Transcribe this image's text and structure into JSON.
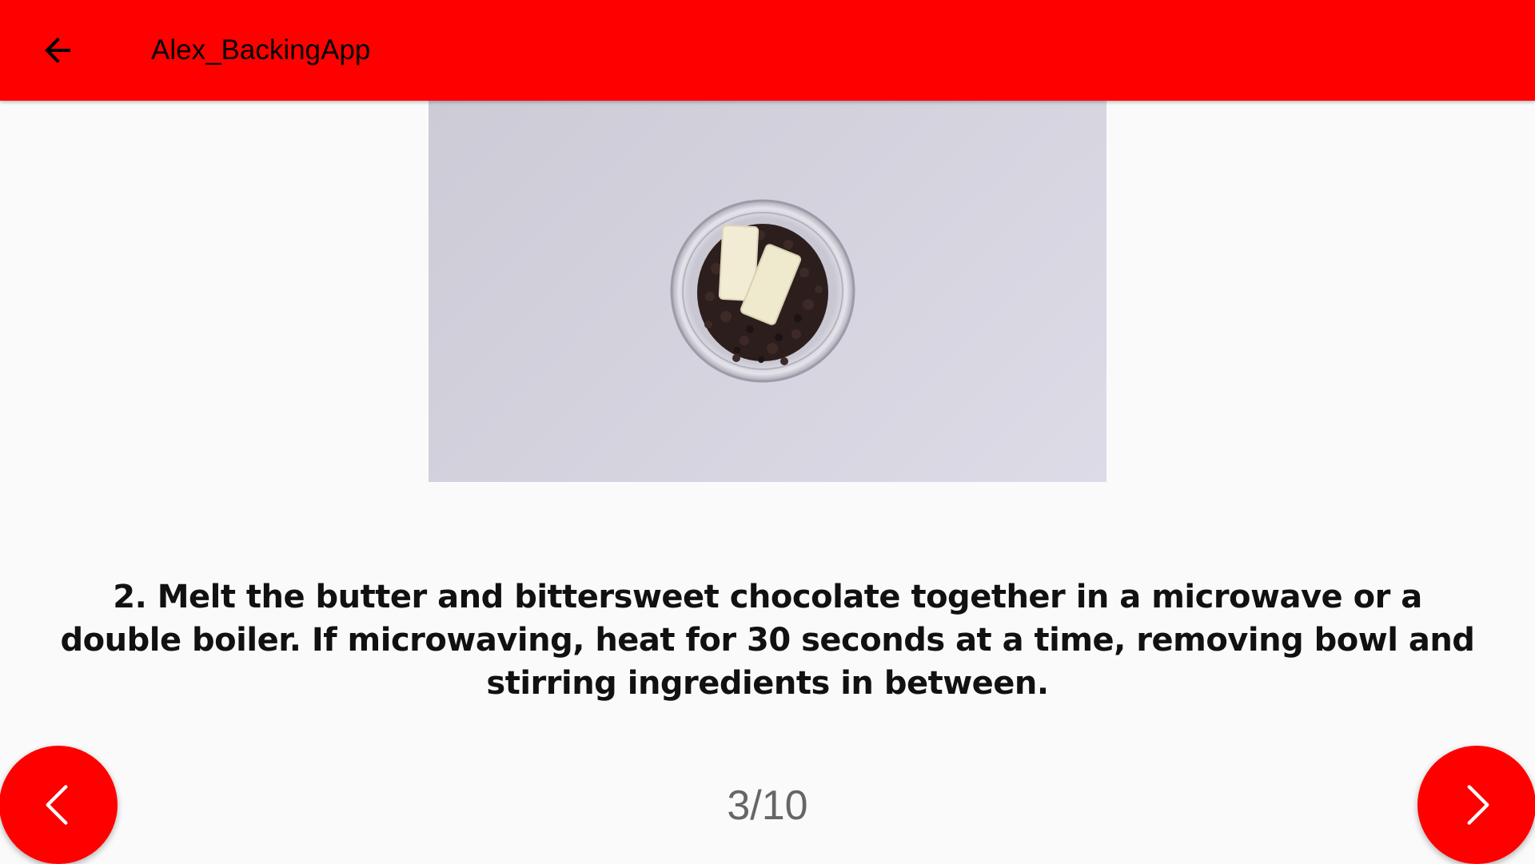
{
  "app_bar": {
    "title": "Alex_BackingApp",
    "back_icon": "arrow-back-icon",
    "background_color": "#ff0000"
  },
  "video": {
    "thumbnail_subject": "glass bowl with chocolate chips and two sticks of butter"
  },
  "step": {
    "description": "2. Melt the butter and bittersweet chocolate together in a microwave or a double boiler. If microwaving, heat for 30 seconds at a time, removing bowl and stirring ingredients in between.",
    "counter": "3/10"
  },
  "navigation": {
    "prev_icon": "chevron-left-icon",
    "next_icon": "chevron-right-icon",
    "button_color": "#ff0000"
  }
}
